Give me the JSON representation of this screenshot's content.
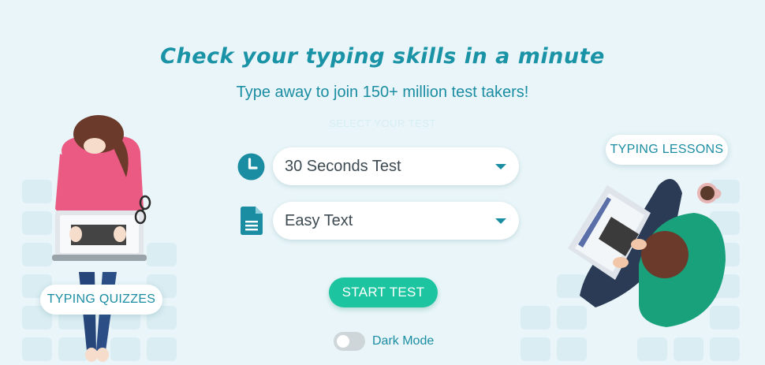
{
  "header": {
    "title": "Check your typing skills in a minute",
    "subtitle": "Type away to join 150+ million test takers!",
    "select_label": "SELECT YOUR TEST"
  },
  "duration_select": {
    "value": "30 Seconds Test"
  },
  "text_select": {
    "value": "Easy Text"
  },
  "start_button": {
    "label": "START TEST"
  },
  "dark_mode": {
    "label": "Dark Mode",
    "enabled": false
  },
  "links": {
    "typing_quizzes": "TYPING QUIZZES",
    "typing_lessons": "TYPING LESSONS"
  },
  "icons": {
    "duration": "clock-icon",
    "text": "document-icon",
    "left_illustration": "woman-laptop-illustration",
    "right_illustration": "man-laptop-illustration"
  },
  "colors": {
    "brand": "#1b93a7",
    "start_button": "#1cc4a0",
    "background": "#e9f5f8"
  }
}
